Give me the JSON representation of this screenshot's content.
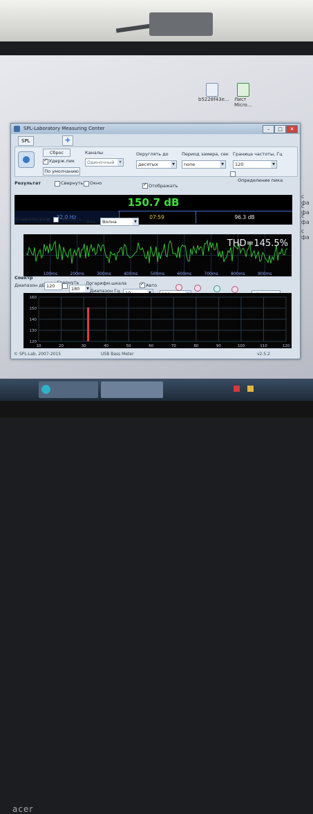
{
  "desktop": {
    "icons": [
      {
        "label": "b5228f43e...",
        "icon": "audio-file-icon"
      },
      {
        "label": "Лист Micro...",
        "icon": "excel-file-icon"
      }
    ],
    "side_text": [
      "с фа",
      "с фа",
      "с фа",
      "с фа"
    ]
  },
  "window": {
    "title": "SPL-Laboratory Measuring Center",
    "tab_label": "SPL",
    "controls": {
      "minimize": "–",
      "maximize": "□",
      "close": "✕"
    }
  },
  "settings": {
    "reset_label": "Сброс",
    "hold_label": "Удерж.пик",
    "default_label": "По умолчанию",
    "channels_label": "Каналы",
    "channels_value": "Одиночный",
    "round_label": "Округлять до",
    "round_value": "десятых",
    "period_label": "Период замера, сек",
    "period_value": "none",
    "freq_limit_label": "Граница частоты, Гц",
    "freq_limit_value": "120",
    "peak_detect_label": "Определение пика"
  },
  "result": {
    "label": "Результат",
    "collapse_label": "Свернуть",
    "window_label": "Окно",
    "show_label": "Отображать",
    "main_value": "150.7 dB",
    "freq_value": "32.0 Hz",
    "time_value": "07:59",
    "min_value": "96.3 dB"
  },
  "oscilloscope": {
    "label": "Осциллограф",
    "collapse_label": "Свернуть",
    "view_label": "Вид",
    "view_value": "Волна",
    "thd_text": "THD=145.5%",
    "time_ticks": [
      "100ms",
      "200ms",
      "300ms",
      "400ms",
      "500ms",
      "600ms",
      "700ms",
      "800ms",
      "900ms"
    ]
  },
  "spectrum": {
    "label": "Спектр",
    "collapse_label": "Свернуть",
    "range_db_label": "Диапазон дБ",
    "range_db_min": "120",
    "range_db_max": "180",
    "log_scale_label": "Логарифм.шкала",
    "range_hz_label": "Диапазон Гц",
    "range_hz_min": "10",
    "range_hz_max": "120",
    "auto_label": "Авто",
    "export_label": "Экспорт",
    "y_ticks": [
      "160",
      "150",
      "140",
      "130",
      "120"
    ],
    "x_ticks": [
      "10",
      "20",
      "30",
      "40",
      "50",
      "60",
      "70",
      "80",
      "90",
      "100",
      "110",
      "120"
    ],
    "peak_freq": 32,
    "peak_level": 150.7
  },
  "statusbar": {
    "copyright": "© SPL-Lab, 2007-2015",
    "app_name": "USB Bass Meter",
    "version": "v2.5.2"
  },
  "bezel": {
    "brand": "acer"
  },
  "colors": {
    "display_green": "#3fe03a",
    "display_blue": "#4b6fd0",
    "wave_green": "#37c23b",
    "peak_red": "#e04040"
  }
}
